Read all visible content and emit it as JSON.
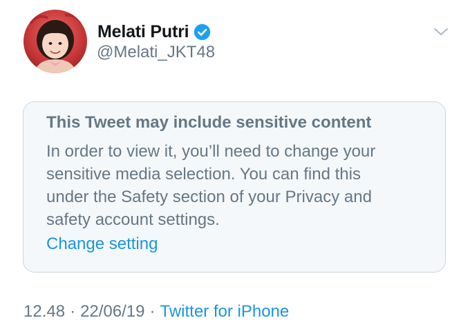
{
  "author": {
    "display_name": "Melati Putri",
    "handle": "@Melati_JKT48",
    "verified": true,
    "verified_icon": "verified-badge-icon",
    "avatar_icon": "profile-photo"
  },
  "menu": {
    "icon": "chevron-down-icon"
  },
  "sensitive_notice": {
    "title": "This Tweet may include sensitive content",
    "body_lines": [
      "In order to view it, you’ll need to change your",
      "sensitive media selection. You can find this",
      "under the Safety section of your Privacy and",
      "safety account settings."
    ],
    "link_label": "Change setting"
  },
  "meta": {
    "time": "12.48",
    "separator": "·",
    "date": "22/06/19",
    "source": "Twitter for iPhone"
  },
  "colors": {
    "text_primary": "#14171a",
    "text_secondary": "#657786",
    "link": "#1b95e0",
    "verified": "#1da1f2",
    "notice_bg": "#f5f8fa",
    "notice_border": "#ccd6dd"
  }
}
